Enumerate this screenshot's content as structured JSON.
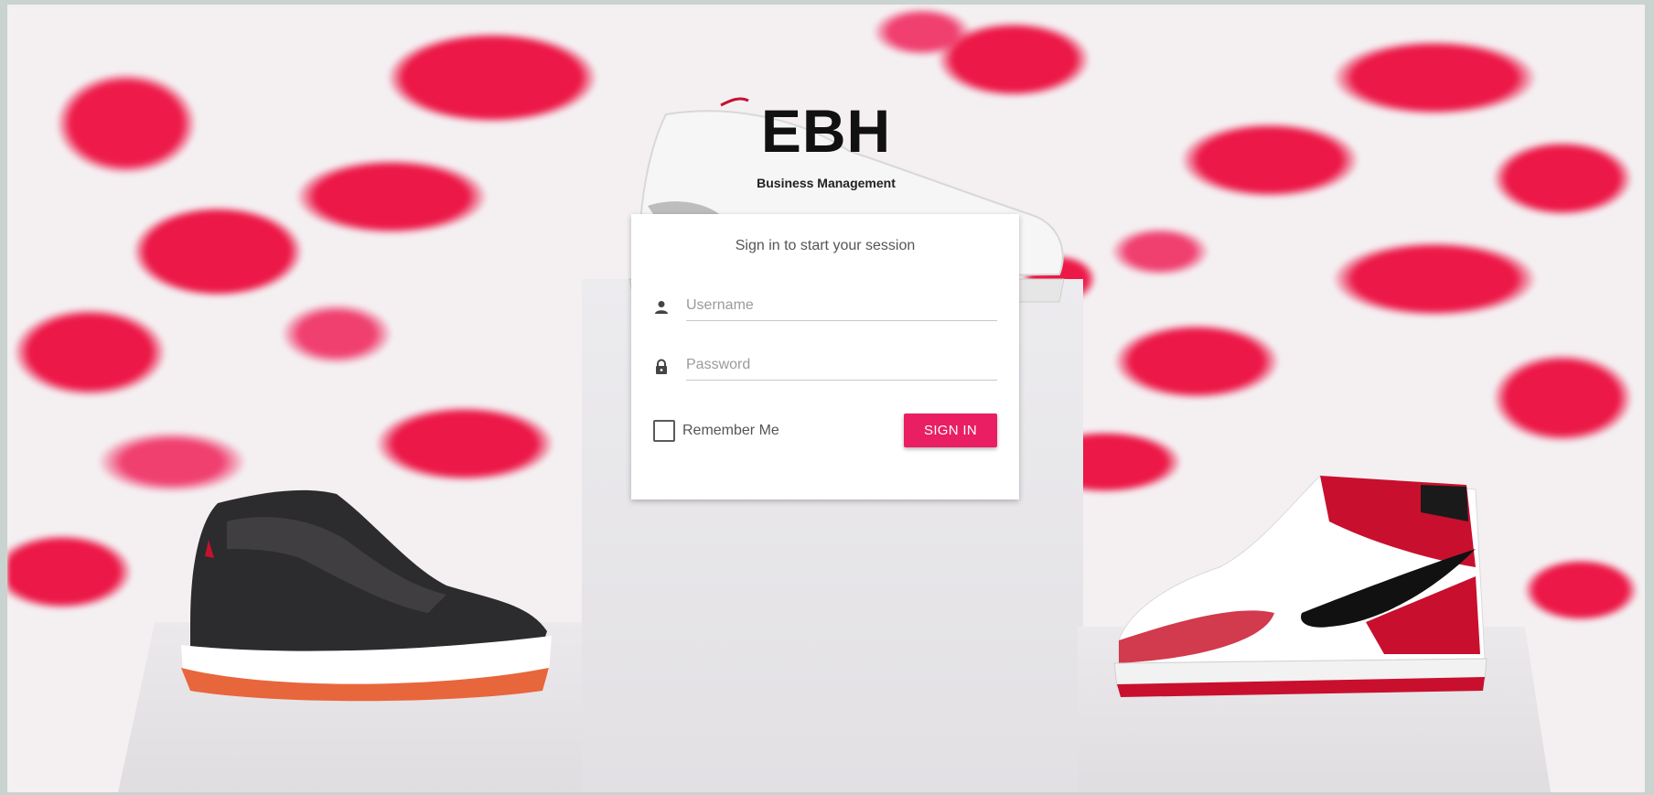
{
  "brand": {
    "title": "EBH",
    "subtitle": "Business Management"
  },
  "login": {
    "message": "Sign in to start your session",
    "username": {
      "placeholder": "Username",
      "value": "",
      "icon": "person-icon"
    },
    "password": {
      "placeholder": "Password",
      "value": "",
      "icon": "lock-icon"
    },
    "remember_label": "Remember Me",
    "remember_checked": false,
    "signin_label": "SIGN IN"
  },
  "colors": {
    "accent": "#e91e63",
    "background_pattern": "#ec1847"
  }
}
